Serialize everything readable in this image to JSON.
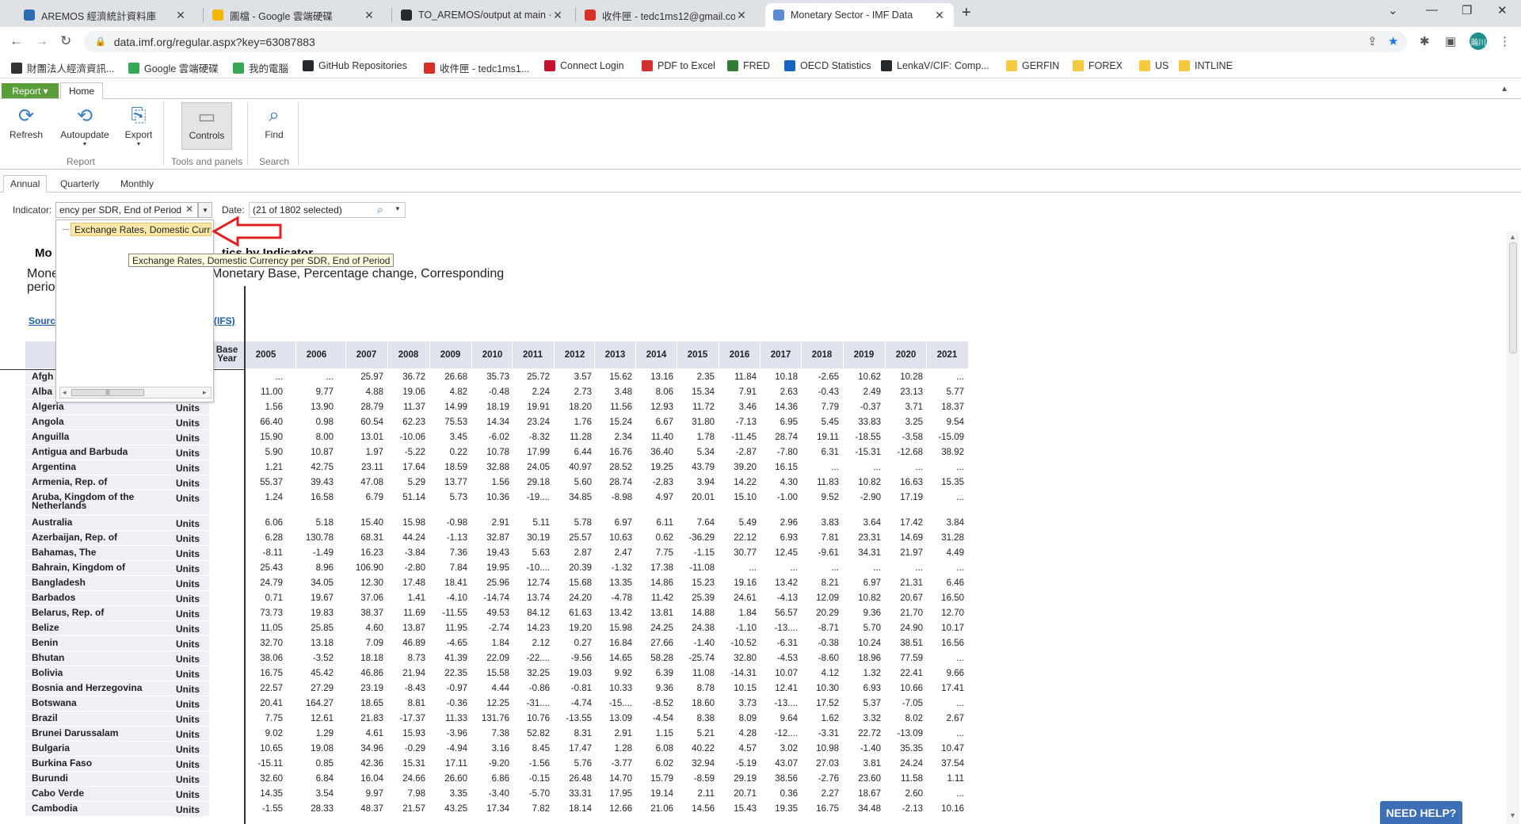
{
  "browser": {
    "tabs": [
      {
        "title": "AREMOS 經濟統計資料庫",
        "active": false,
        "icon": "aremos-icon",
        "color": "#2b6cb0"
      },
      {
        "title": "圖檔 - Google 雲端硬碟",
        "active": false,
        "icon": "google-drive-icon",
        "color": "#f4b400"
      },
      {
        "title": "TO_AREMOS/output at main · ",
        "active": false,
        "icon": "github-icon",
        "color": "#24292e"
      },
      {
        "title": "收件匣 - tedc1ms12@gmail.co",
        "active": false,
        "icon": "gmail-icon",
        "color": "#d93025"
      },
      {
        "title": "Monetary Sector - IMF Data",
        "active": true,
        "icon": "imf-icon",
        "color": "#5b8bd0"
      }
    ],
    "url": "data.imf.org/regular.aspx?key=63087883",
    "profile_initial": "瀚川",
    "bookmarks": [
      {
        "label": "財團法人經濟資訊...",
        "icon": "site-icon"
      },
      {
        "label": "Google 雲端硬碟",
        "icon": "google-drive-icon"
      },
      {
        "label": "我的電腦",
        "icon": "google-drive-icon"
      },
      {
        "label": "GitHub Repositories",
        "icon": "github-icon"
      },
      {
        "label": "收件匣 - tedc1ms1...",
        "icon": "gmail-icon"
      },
      {
        "label": "Connect Login",
        "icon": "flag-icon"
      },
      {
        "label": "PDF to Excel",
        "icon": "pdf-icon"
      },
      {
        "label": "FRED",
        "icon": "chart-icon"
      },
      {
        "label": "OECD Statistics",
        "icon": "oecd-icon"
      },
      {
        "label": "LenkaV/CIF: Comp...",
        "icon": "github-icon"
      },
      {
        "label": "GERFIN",
        "icon": "folder-icon"
      },
      {
        "label": "FOREX",
        "icon": "folder-icon"
      },
      {
        "label": "US",
        "icon": "folder-icon"
      },
      {
        "label": "INTLINE",
        "icon": "folder-icon"
      }
    ]
  },
  "ribbon": {
    "report_label": "Report ▾",
    "home_tab": "Home",
    "buttons": {
      "refresh": "Refresh",
      "autoupdate": "Autoupdate",
      "export": "Export",
      "controls": "Controls",
      "find": "Find"
    },
    "groups": {
      "report": "Report",
      "tools": "Tools and panels",
      "search": "Search"
    }
  },
  "view_tabs": [
    "Annual",
    "Quarterly",
    "Monthly"
  ],
  "filters": {
    "indicator_label": "Indicator:",
    "indicator_value": "ency per SDR, End of Period",
    "date_label": "Date:",
    "date_value": "(21 of 1802 selected)"
  },
  "dropdown": {
    "item": "Exchange Rates, Domestic Curr",
    "tooltip": "Exchange Rates, Domestic Currency per SDR, End of Period"
  },
  "content": {
    "title_left": "Mo",
    "title_right": "tics by Indicator",
    "subtitle_left": "Mone",
    "subtitle_left2": "perio",
    "subtitle_right": "Monetary Base, Percentage change, Corresponding",
    "source_left": "Sourc",
    "source_right": "(IFS)"
  },
  "table": {
    "base_year_header": "Base Year",
    "years": [
      "2005",
      "2006",
      "2007",
      "2008",
      "2009",
      "2010",
      "2011",
      "2012",
      "2013",
      "2014",
      "2015",
      "2016",
      "2017",
      "2018",
      "2019",
      "2020",
      "2021"
    ],
    "rows": [
      {
        "name": "Afgh",
        "unit": "",
        "values": [
          "...",
          "...",
          "25.97",
          "36.72",
          "26.68",
          "35.73",
          "25.72",
          "3.57",
          "15.62",
          "13.16",
          "2.35",
          "11.84",
          "10.18",
          "-2.65",
          "10.62",
          "10.28",
          "..."
        ]
      },
      {
        "name": "Alba",
        "unit": "",
        "values": [
          "11.00",
          "9.77",
          "4.88",
          "19.06",
          "4.82",
          "-0.48",
          "2.24",
          "2.73",
          "3.48",
          "8.06",
          "15.34",
          "7.91",
          "2.63",
          "-0.43",
          "2.49",
          "23.13",
          "5.77"
        ]
      },
      {
        "name": "Algeria",
        "unit": "Units",
        "values": [
          "1.56",
          "13.90",
          "28.79",
          "11.37",
          "14.99",
          "18.19",
          "19.91",
          "18.20",
          "11.56",
          "12.93",
          "11.72",
          "3.46",
          "14.36",
          "7.79",
          "-0.37",
          "3.71",
          "18.37"
        ]
      },
      {
        "name": "Angola",
        "unit": "Units",
        "values": [
          "66.40",
          "0.98",
          "60.54",
          "62.23",
          "75.53",
          "14.34",
          "23.24",
          "1.76",
          "15.24",
          "6.67",
          "31.80",
          "-7.13",
          "6.95",
          "5.45",
          "33.83",
          "3.25",
          "9.54"
        ]
      },
      {
        "name": "Anguilla",
        "unit": "Units",
        "values": [
          "15.90",
          "8.00",
          "13.01",
          "-10.06",
          "3.45",
          "-6.02",
          "-8.32",
          "11.28",
          "2.34",
          "11.40",
          "1.78",
          "-11.45",
          "28.74",
          "19.11",
          "-18.55",
          "-3.58",
          "-15.09"
        ]
      },
      {
        "name": "Antigua and Barbuda",
        "unit": "Units",
        "values": [
          "5.90",
          "10.87",
          "1.97",
          "-5.22",
          "0.22",
          "10.78",
          "17.99",
          "6.44",
          "16.76",
          "36.40",
          "5.34",
          "-2.87",
          "-7.80",
          "6.31",
          "-15.31",
          "-12.68",
          "38.92"
        ]
      },
      {
        "name": "Argentina",
        "unit": "Units",
        "values": [
          "1.21",
          "42.75",
          "23.11",
          "17.64",
          "18.59",
          "32.88",
          "24.05",
          "40.97",
          "28.52",
          "19.25",
          "43.79",
          "39.20",
          "16.15",
          "...",
          "...",
          "...",
          "..."
        ]
      },
      {
        "name": "Armenia, Rep. of",
        "unit": "Units",
        "values": [
          "55.37",
          "39.43",
          "47.08",
          "5.29",
          "13.77",
          "1.56",
          "29.18",
          "5.60",
          "28.74",
          "-2.83",
          "3.94",
          "14.22",
          "4.30",
          "11.83",
          "10.82",
          "16.63",
          "15.35"
        ]
      },
      {
        "name": "Aruba, Kingdom of the Netherlands",
        "unit": "Units",
        "values": [
          "1.24",
          "16.58",
          "6.79",
          "51.14",
          "5.73",
          "10.36",
          "-19....",
          "34.85",
          "-8.98",
          "4.97",
          "20.01",
          "15.10",
          "-1.00",
          "9.52",
          "-2.90",
          "17.19",
          "..."
        ],
        "tall": true
      },
      {
        "name": "Australia",
        "unit": "Units",
        "values": [
          "6.06",
          "5.18",
          "15.40",
          "15.98",
          "-0.98",
          "2.91",
          "5.11",
          "5.78",
          "6.97",
          "6.11",
          "7.64",
          "5.49",
          "2.96",
          "3.83",
          "3.64",
          "17.42",
          "3.84"
        ]
      },
      {
        "name": "Azerbaijan, Rep. of",
        "unit": "Units",
        "values": [
          "6.28",
          "130.78",
          "68.31",
          "44.24",
          "-1.13",
          "32.87",
          "30.19",
          "25.57",
          "10.63",
          "0.62",
          "-36.29",
          "22.12",
          "6.93",
          "7.81",
          "23.31",
          "14.69",
          "31.28"
        ]
      },
      {
        "name": "Bahamas, The",
        "unit": "Units",
        "values": [
          "-8.11",
          "-1.49",
          "16.23",
          "-3.84",
          "7.36",
          "19.43",
          "5.63",
          "2.87",
          "2.47",
          "7.75",
          "-1.15",
          "30.77",
          "12.45",
          "-9.61",
          "34.31",
          "21.97",
          "4.49"
        ]
      },
      {
        "name": "Bahrain, Kingdom of",
        "unit": "Units",
        "values": [
          "25.43",
          "8.96",
          "106.90",
          "-2.80",
          "7.84",
          "19.95",
          "-10....",
          "20.39",
          "-1.32",
          "17.38",
          "-11.08",
          "...",
          "...",
          "...",
          "...",
          "...",
          "..."
        ]
      },
      {
        "name": "Bangladesh",
        "unit": "Units",
        "values": [
          "24.79",
          "34.05",
          "12.30",
          "17.48",
          "18.41",
          "25.96",
          "12.74",
          "15.68",
          "13.35",
          "14.86",
          "15.23",
          "19.16",
          "13.42",
          "8.21",
          "6.97",
          "21.31",
          "6.46"
        ]
      },
      {
        "name": "Barbados",
        "unit": "Units",
        "values": [
          "0.71",
          "19.67",
          "37.06",
          "1.41",
          "-4.10",
          "-14.74",
          "13.74",
          "24.20",
          "-4.78",
          "11.42",
          "25.39",
          "24.61",
          "-4.13",
          "12.09",
          "10.82",
          "20.67",
          "16.50"
        ]
      },
      {
        "name": "Belarus, Rep. of",
        "unit": "Units",
        "values": [
          "73.73",
          "19.83",
          "38.37",
          "11.69",
          "-11.55",
          "49.53",
          "84.12",
          "61.63",
          "13.42",
          "13.81",
          "14.88",
          "1.84",
          "56.57",
          "20.29",
          "9.36",
          "21.70",
          "12.70"
        ]
      },
      {
        "name": "Belize",
        "unit": "Units",
        "values": [
          "11.05",
          "25.85",
          "4.60",
          "13.87",
          "11.95",
          "-2.74",
          "14.23",
          "19.20",
          "15.98",
          "24.25",
          "24.38",
          "-1.10",
          "-13....",
          "-8.71",
          "5.70",
          "24.90",
          "10.17"
        ]
      },
      {
        "name": "Benin",
        "unit": "Units",
        "values": [
          "32.70",
          "13.18",
          "7.09",
          "46.89",
          "-4.65",
          "1.84",
          "2.12",
          "0.27",
          "16.84",
          "27.66",
          "-1.40",
          "-10.52",
          "-6.31",
          "-0.38",
          "10.24",
          "38.51",
          "16.56"
        ]
      },
      {
        "name": "Bhutan",
        "unit": "Units",
        "values": [
          "38.06",
          "-3.52",
          "18.18",
          "8.73",
          "41.39",
          "22.09",
          "-22....",
          "-9.56",
          "14.65",
          "58.28",
          "-25.74",
          "32.80",
          "-4.53",
          "-8.60",
          "18.96",
          "77.59",
          "..."
        ]
      },
      {
        "name": "Bolivia",
        "unit": "Units",
        "values": [
          "16.75",
          "45.42",
          "46.86",
          "21.94",
          "22.35",
          "15.58",
          "32.25",
          "19.03",
          "9.92",
          "6.39",
          "11.08",
          "-14.31",
          "10.07",
          "4.12",
          "1.32",
          "22.41",
          "9.66"
        ]
      },
      {
        "name": "Bosnia and Herzegovina",
        "unit": "Units",
        "values": [
          "22.57",
          "27.29",
          "23.19",
          "-8.43",
          "-0.97",
          "4.44",
          "-0.86",
          "-0.81",
          "10.33",
          "9.36",
          "8.78",
          "10.15",
          "12.41",
          "10.30",
          "6.93",
          "10.66",
          "17.41"
        ]
      },
      {
        "name": "Botswana",
        "unit": "Units",
        "values": [
          "20.41",
          "164.27",
          "18.65",
          "8.81",
          "-0.36",
          "12.25",
          "-31....",
          "-4.74",
          "-15....",
          "-8.52",
          "18.60",
          "3.73",
          "-13....",
          "17.52",
          "5.37",
          "-7.05",
          "..."
        ]
      },
      {
        "name": "Brazil",
        "unit": "Units",
        "values": [
          "7.75",
          "12.61",
          "21.83",
          "-17.37",
          "11.33",
          "131.76",
          "10.76",
          "-13.55",
          "13.09",
          "-4.54",
          "8.38",
          "8.09",
          "9.64",
          "1.62",
          "3.32",
          "8.02",
          "2.67"
        ]
      },
      {
        "name": "Brunei Darussalam",
        "unit": "Units",
        "values": [
          "9.02",
          "1.29",
          "4.61",
          "15.93",
          "-3.96",
          "7.38",
          "52.82",
          "8.31",
          "2.91",
          "1.15",
          "5.21",
          "4.28",
          "-12....",
          "-3.31",
          "22.72",
          "-13.09",
          "..."
        ]
      },
      {
        "name": "Bulgaria",
        "unit": "Units",
        "values": [
          "10.65",
          "19.08",
          "34.96",
          "-0.29",
          "-4.94",
          "3.16",
          "8.45",
          "17.47",
          "1.28",
          "6.08",
          "40.22",
          "4.57",
          "3.02",
          "10.98",
          "-1.40",
          "35.35",
          "10.47"
        ]
      },
      {
        "name": "Burkina Faso",
        "unit": "Units",
        "values": [
          "-15.11",
          "0.85",
          "42.36",
          "15.31",
          "17.11",
          "-9.20",
          "-1.56",
          "5.76",
          "-3.77",
          "6.02",
          "32.94",
          "-5.19",
          "43.07",
          "27.03",
          "3.81",
          "24.24",
          "37.54"
        ]
      },
      {
        "name": "Burundi",
        "unit": "Units",
        "values": [
          "32.60",
          "6.84",
          "16.04",
          "24.66",
          "26.60",
          "6.86",
          "-0.15",
          "26.48",
          "14.70",
          "15.79",
          "-8.59",
          "29.19",
          "38.56",
          "-2.76",
          "23.60",
          "11.58",
          "1.11"
        ]
      },
      {
        "name": "Cabo Verde",
        "unit": "Units",
        "values": [
          "14.35",
          "3.54",
          "9.97",
          "7.98",
          "3.35",
          "-3.40",
          "-5.70",
          "33.31",
          "17.95",
          "19.14",
          "2.11",
          "20.71",
          "0.36",
          "2.27",
          "18.67",
          "2.60",
          "..."
        ]
      },
      {
        "name": "Cambodia",
        "unit": "Units",
        "values": [
          "-1.55",
          "28.33",
          "48.37",
          "21.57",
          "43.25",
          "17.34",
          "7.82",
          "18.14",
          "12.66",
          "21.06",
          "14.56",
          "15.43",
          "19.35",
          "16.75",
          "34.48",
          "-2.13",
          "10.16"
        ]
      }
    ]
  },
  "help_button": "NEED HELP?"
}
